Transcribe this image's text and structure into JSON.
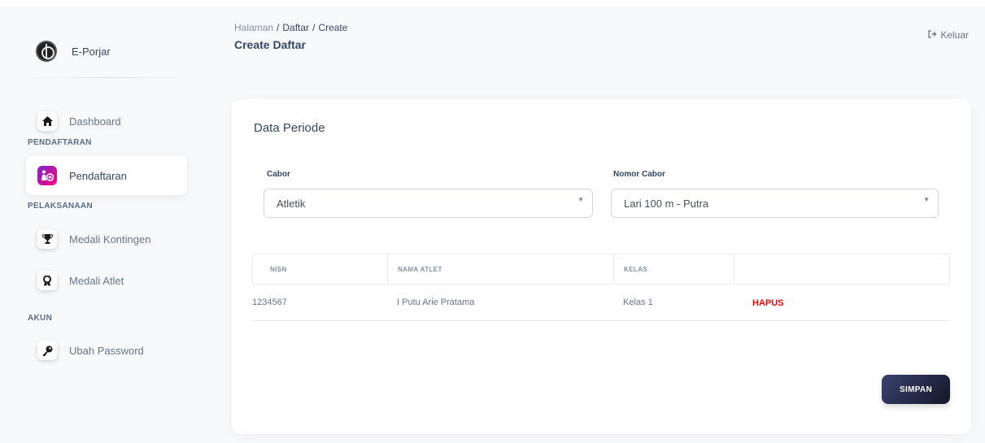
{
  "brand": {
    "name": "E-Porjar"
  },
  "sidebar": {
    "items": [
      {
        "label": "Dashboard",
        "icon": "home-icon"
      },
      {
        "label": "Pendaftaran",
        "icon": "user-add-icon",
        "active": true
      },
      {
        "label": "Medali Kontingen",
        "icon": "trophy-icon"
      },
      {
        "label": "Medali Atlet",
        "icon": "medal-icon"
      },
      {
        "label": "Ubah Password",
        "icon": "key-icon"
      }
    ],
    "sections": {
      "pendaftaran": "PENDAFTARAN",
      "pelaksanaan": "PELAKSANAAN",
      "akun": "AKUN"
    }
  },
  "header": {
    "breadcrumb": [
      "Halaman",
      "Daftar",
      "Create"
    ],
    "title": "Create Daftar",
    "logout_label": "Keluar"
  },
  "card": {
    "title": "Data Periode",
    "cabor": {
      "label": "Cabor",
      "value": "Atletik"
    },
    "nomor_cabor": {
      "label": "Nomor Cabor",
      "value": "Lari 100 m - Putra"
    },
    "table": {
      "headers": [
        "NISN",
        "NAMA ATLET",
        "KELAS",
        ""
      ],
      "rows": [
        {
          "nisn": "1234567",
          "nama": "I Putu Arie Pratama",
          "kelas": "Kelas 1",
          "action": "HAPUS"
        }
      ]
    },
    "save_label": "SIMPAN"
  },
  "colors": {
    "accent_gradient_start": "#7928ca",
    "accent_gradient_end": "#ff0080",
    "danger": "#ea0606",
    "button_dark": "#141727"
  }
}
